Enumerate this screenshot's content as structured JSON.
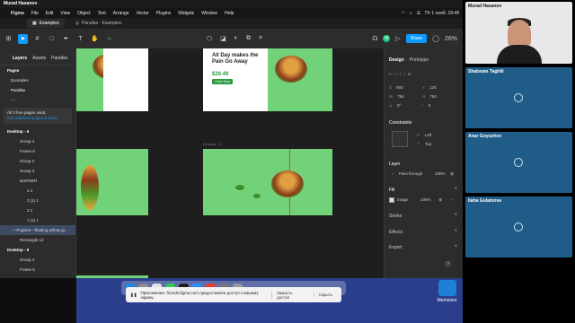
{
  "presenter": "Murad Hasanov",
  "menubar": {
    "app": "Figma",
    "items": [
      "File",
      "Edit",
      "View",
      "Object",
      "Text",
      "Arrange",
      "Vector",
      "Plugins",
      "Widgets",
      "Window",
      "Help"
    ],
    "datetime": "Пт 1 нояб. 19:49"
  },
  "tabs": [
    {
      "label": "Examples",
      "active": true
    },
    {
      "label": "Parallax - Examples",
      "active": false
    }
  ],
  "toolbar": {
    "share_label": "Share",
    "zoom": "26%",
    "avatar": "M"
  },
  "left_panel": {
    "tabs": [
      "Layers",
      "Assets",
      "Parallax"
    ],
    "pages_label": "Pages",
    "pages": [
      "Examples",
      "Parallax",
      "---"
    ],
    "notice_text": "All 3 free pages used.",
    "notice_link": "Get unlimited pages & more",
    "layers": [
      "Desktop - 6",
      "Group 4",
      "Frame 5",
      "Group 2",
      "Group 3",
      "BURGER",
      "4 1",
      "3 (1) 1",
      "2 1",
      "1 (1) 1",
      "—Pngtree—floating yellow gr...",
      "Rectangle 12",
      "Desktop - 5",
      "Group 4",
      "Frame 5"
    ],
    "highlighted_layer": "—Pngtree—floating yellow gr..."
  },
  "canvas": {
    "frame_label": "Desktop - 6",
    "headline_1": "All Day makes the",
    "headline_2": "Pain Go Away",
    "price": "$20.49",
    "cta": "Order Now"
  },
  "right_panel": {
    "tabs": [
      "Design",
      "Prototype"
    ],
    "x": "593",
    "y": "120",
    "w": "784",
    "h": "764",
    "rotation": "0°",
    "radius": "0",
    "constraints_label": "Constraints",
    "constraint_h": "Left",
    "constraint_v": "Top",
    "layer_label": "Layer",
    "blend": "Pass through",
    "opacity": "100%",
    "fill_label": "Fill",
    "fill_type": "Image",
    "fill_opacity": "100%",
    "stroke_label": "Stroke",
    "effects_label": "Effects",
    "export_label": "Export",
    "help": "?"
  },
  "dock": {
    "share_message": "Приложение: friends.figma.com предоставлен доступ к вашему экрану.",
    "stop_label": "Закрыть доступ",
    "hide_label": "Скрыть",
    "memories_label": "Memories"
  },
  "participants": [
    {
      "name": "Murad Hasanov",
      "video": true
    },
    {
      "name": "Shabnam Taghili",
      "video": false
    },
    {
      "name": "Anar Goyushov",
      "video": false
    },
    {
      "name": "Ilaha Gulamova",
      "video": false
    }
  ]
}
